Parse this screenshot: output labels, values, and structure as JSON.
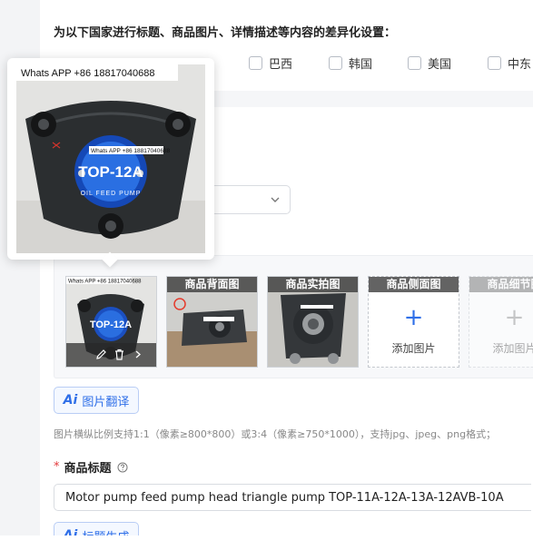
{
  "settings": {
    "heading": "为以下国家进行标题、商品图片、详情描述等内容的差异化设置：",
    "countries": [
      "巴西",
      "韩国",
      "美国",
      "中东"
    ]
  },
  "preview": {
    "watermark": "Whats APP +86 18817040688",
    "center_watermark": "Whats APP +86 18817040688",
    "model_text": "TOP-12A",
    "ring_text": "OIL FEED PUMP"
  },
  "images": {
    "slots": [
      {
        "caption": "",
        "type": "pump-front"
      },
      {
        "caption": "商品背面图",
        "type": "pump-back"
      },
      {
        "caption": "商品实拍图",
        "type": "pump-real"
      },
      {
        "caption": "商品侧面图",
        "type": "add",
        "add_label": "添加图片"
      },
      {
        "caption": "商品细节图",
        "type": "add-faded",
        "add_label": "添加图片"
      }
    ],
    "thumb_watermark": "Whats APP +86 18817040688",
    "thumb_model": "TOP-12A",
    "translate_button": "图片翻译",
    "translate_ai": "Ai",
    "hint": "图片横纵比例支持1:1（像素≥800*800）或3:4（像素≥750*1000），支持jpg、jpeg、png格式；"
  },
  "title_field": {
    "required_mark": "*",
    "label": "商品标题",
    "value": "Motor pump feed pump head triangle pump TOP-11A-12A-13A-12AVB-10A",
    "generate_button": "标题生成",
    "generate_ai": "Ai"
  },
  "colors": {
    "accent": "#2f6fe8",
    "required": "#e4393c"
  }
}
